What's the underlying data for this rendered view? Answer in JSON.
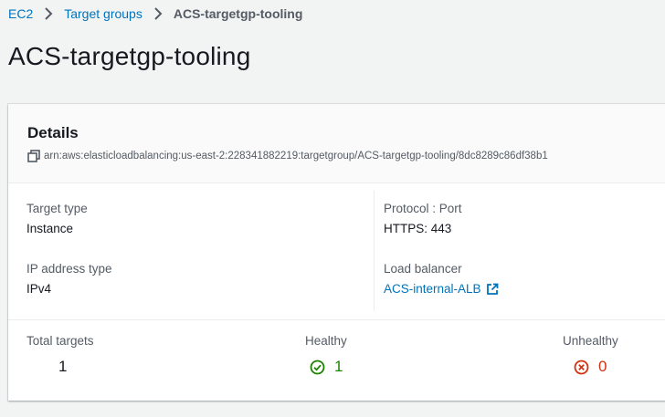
{
  "breadcrumb": [
    {
      "label": "EC2"
    },
    {
      "label": "Target groups"
    },
    {
      "label": "ACS-targetgp-tooling"
    }
  ],
  "page_title": "ACS-targetgp-tooling",
  "details": {
    "title": "Details",
    "arn": "arn:aws:elasticloadbalancing:us-east-2:228341882219:targetgroup/ACS-targetgp-tooling/8dc8289c86df38b1",
    "target_type": {
      "label": "Target type",
      "value": "Instance"
    },
    "ip_address_type": {
      "label": "IP address type",
      "value": "IPv4"
    },
    "protocol_port": {
      "label": "Protocol : Port",
      "value": "HTTPS: 443"
    },
    "load_balancer": {
      "label": "Load balancer",
      "value": "ACS-internal-ALB"
    }
  },
  "stats": {
    "total": {
      "label": "Total targets",
      "value": "1"
    },
    "healthy": {
      "label": "Healthy",
      "value": "1"
    },
    "unhealthy": {
      "label": "Unhealthy",
      "value": "0"
    }
  },
  "icons": {
    "breadcrumb_separator": "chevron-right-icon",
    "copy": "copy-icon",
    "external_link": "external-link-icon",
    "healthy": "check-circle-icon",
    "unhealthy": "x-circle-icon"
  },
  "colors": {
    "link": "#0073bb",
    "healthy": "#1d8102",
    "unhealthy": "#d13212"
  }
}
